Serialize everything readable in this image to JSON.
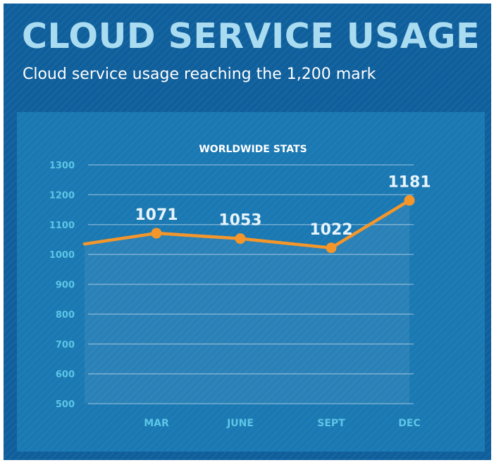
{
  "header": {
    "title": "CLOUD SERVICE USAGE",
    "subtitle": "Cloud service usage reaching the 1,200 mark"
  },
  "colors": {
    "background": "#0f5f9c",
    "panel": "#1a78b2",
    "title": "#a9dcf1",
    "line": "#f5962a",
    "axis_text": "#5cc6e6",
    "data_label": "#e8f4fb"
  },
  "chart_data": {
    "type": "line",
    "title": "WORLDWIDE STATS",
    "xlabel": "",
    "ylabel": "",
    "categories": [
      "MAR",
      "JUNE",
      "SEPT",
      "DEC"
    ],
    "ylim": [
      500,
      1300
    ],
    "yticks": [
      500,
      600,
      700,
      800,
      900,
      1000,
      1100,
      1200,
      1300
    ],
    "grid": true,
    "series": [
      {
        "values": [
          1071,
          1053,
          1022,
          1181
        ],
        "data_labels": [
          "1071",
          "1053",
          "1022",
          "1181"
        ],
        "start_value": 1035
      }
    ]
  }
}
